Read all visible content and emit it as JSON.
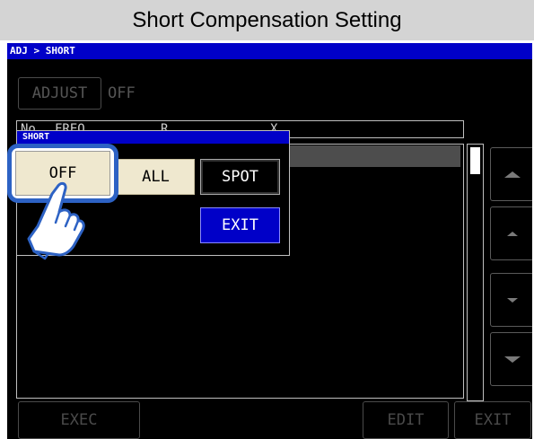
{
  "title": "Short Compensation Setting",
  "breadcrumb": "ADJ > SHORT",
  "adjust": {
    "label": "ADJUST",
    "value": "OFF"
  },
  "list": {
    "columns": [
      "No",
      "FREQ",
      "R",
      "X"
    ]
  },
  "side_buttons": [
    "page-up-icon",
    "scroll-up-icon",
    "scroll-down-icon",
    "page-down-icon"
  ],
  "bottom": {
    "exec": "EXEC",
    "edit": "EDIT",
    "exit": "EXIT"
  },
  "popup": {
    "title": "SHORT",
    "off": "OFF",
    "all": "ALL",
    "spot": "SPOT",
    "exit": "EXIT",
    "selected": "OFF"
  },
  "colors": {
    "accent": "#0000c8",
    "highlight": "#2d62c4",
    "cream": "#efe8cf"
  }
}
